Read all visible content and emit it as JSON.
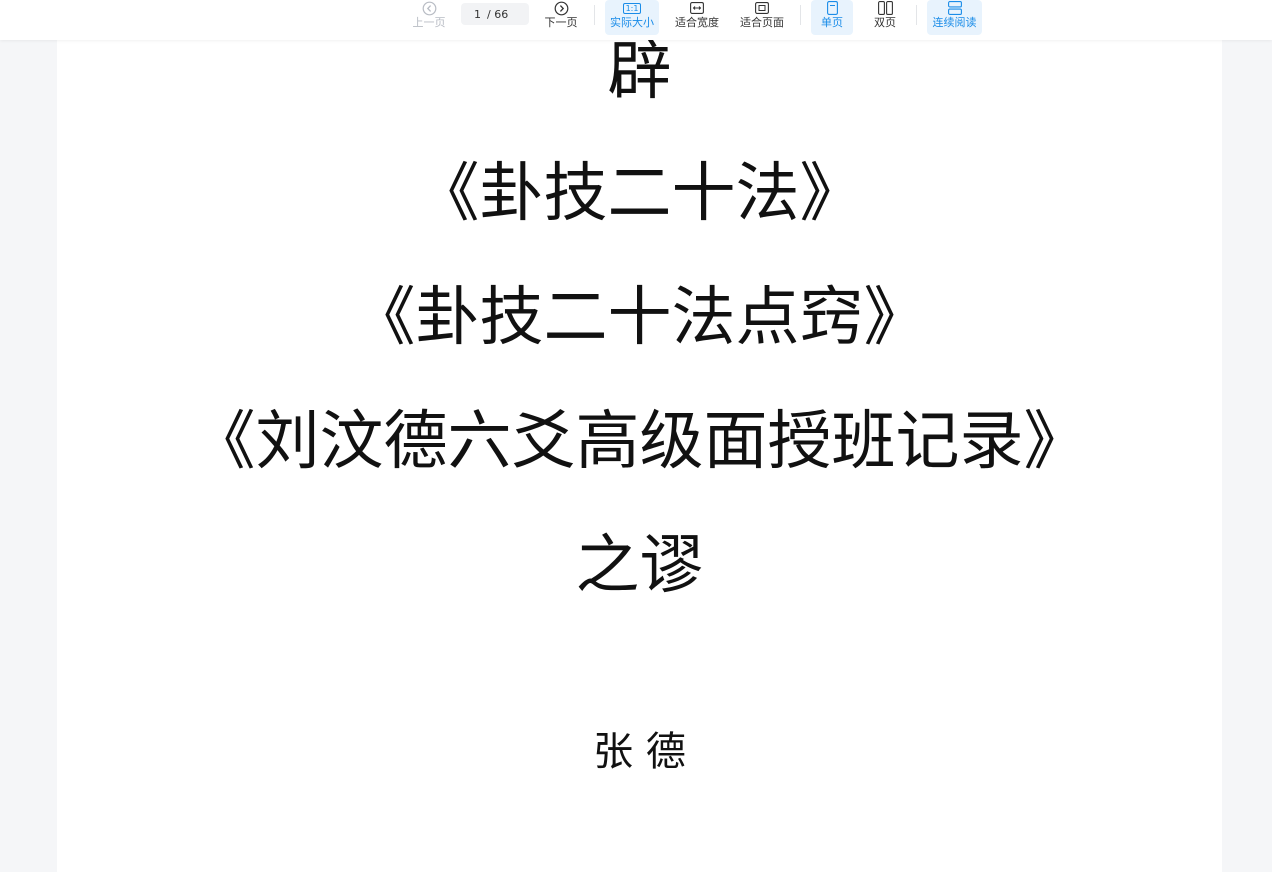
{
  "toolbar": {
    "prev_label": "上一页",
    "page_current": "1",
    "page_total": "/ 66",
    "next_label": "下一页",
    "actual_size_label": "实际大小",
    "actual_size_icon_text": "1:1",
    "fit_width_label": "适合宽度",
    "fit_page_label": "适合页面",
    "single_page_label": "单页",
    "double_page_label": "双页",
    "continuous_label": "连续阅读"
  },
  "document": {
    "lines": [
      "辟",
      "《卦技二十法》",
      "《卦技二十法点窍》",
      "《刘汶德六爻高级面授班记录》",
      "之谬",
      "张 德"
    ]
  },
  "colors": {
    "accent": "#1a8ce8",
    "active_bg": "#e8f3fd",
    "viewer_bg": "#f5f6f8",
    "page_bg": "#ffffff"
  }
}
